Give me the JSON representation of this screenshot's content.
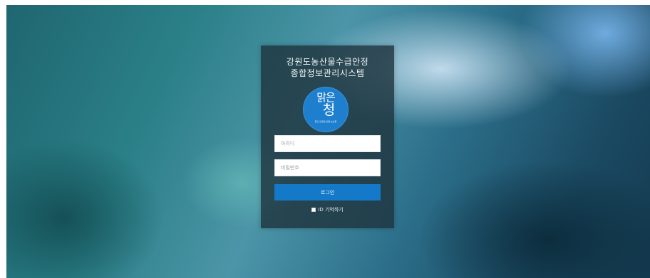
{
  "login": {
    "title_line1": "강원도농산물수급안정",
    "title_line2": "종합정보관리시스템",
    "logo": {
      "text_line1": "맑은",
      "text_line2": "청",
      "tagline": "맑고 안정된 강원 농산물",
      "icon": "maeun-cheong-logo"
    },
    "id_placeholder": "아이디",
    "password_placeholder": "비밀번호",
    "login_button_label": "로그인",
    "remember_id_label": "ID 기억하기",
    "remember_id_checked": false,
    "accent_color": "#1479c9",
    "panel_color": "#1e343e"
  }
}
